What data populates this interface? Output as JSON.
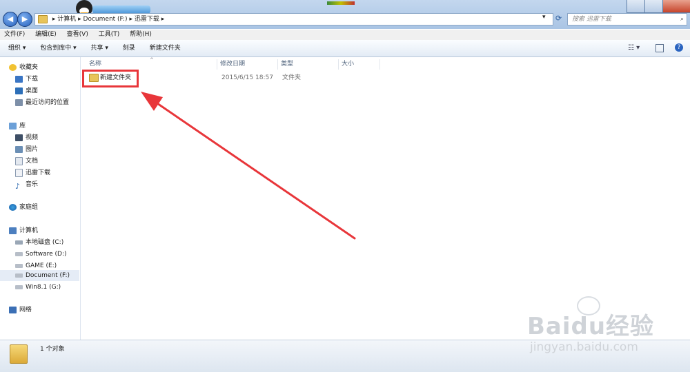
{
  "address": {
    "segments": [
      "计算机",
      "Document (F:)",
      "迅雷下载"
    ],
    "search_placeholder": "搜索 迅雷下载"
  },
  "menu": [
    "文件(F)",
    "编辑(E)",
    "查看(V)",
    "工具(T)",
    "帮助(H)"
  ],
  "toolbar": {
    "organize": "组织 ▾",
    "include_library": "包含到库中 ▾",
    "share": "共享 ▾",
    "burn": "刻录",
    "new_folder": "新建文件夹"
  },
  "nav": {
    "favorites": "收藏夹",
    "downloads": "下载",
    "desktop": "桌面",
    "recent": "最近访问的位置",
    "libraries": "库",
    "videos": "视频",
    "pictures": "图片",
    "documents": "文档",
    "xunlei": "迅雷下载",
    "music": "音乐",
    "homegroup": "家庭组",
    "computer": "计算机",
    "drive_c": "本地磁盘 (C:)",
    "drive_d": "Software (D:)",
    "drive_e": "GAME (E:)",
    "drive_f": "Document (F:)",
    "drive_g": "Win8.1 (G:)",
    "network": "网络"
  },
  "columns": {
    "name": "名称",
    "modified": "修改日期",
    "type": "类型",
    "size": "大小"
  },
  "file": {
    "name": "新建文件夹",
    "modified": "2015/6/15 18:57",
    "type": "文件夹"
  },
  "status": {
    "count": "1 个对象"
  },
  "watermark": {
    "brand": "Baidu经验",
    "url": "jingyan.baidu.com"
  },
  "colors": {
    "highlight": "#e8363a"
  }
}
